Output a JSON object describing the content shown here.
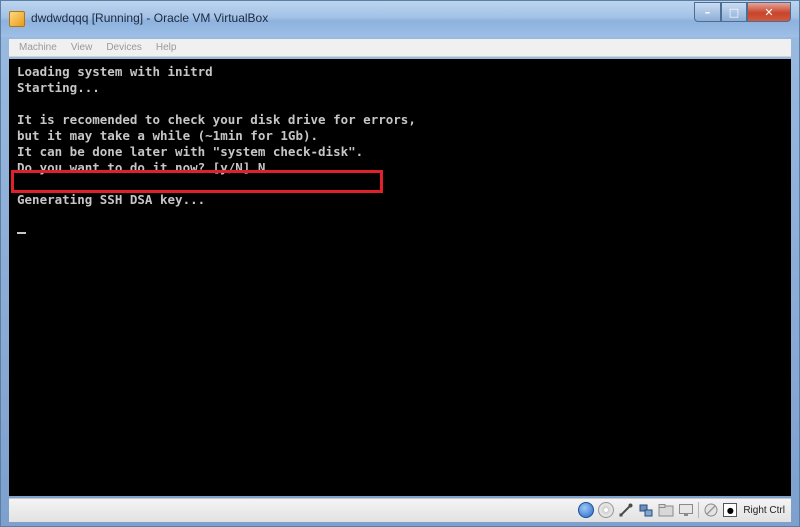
{
  "window": {
    "title": "dwdwdqqq [Running] - Oracle VM VirtualBox"
  },
  "menu": {
    "items": [
      "Machine",
      "View",
      "Devices",
      "Help"
    ]
  },
  "console": {
    "lines": [
      "Loading system with initrd",
      "Starting...",
      "",
      "It is recomended to check your disk drive for errors,",
      "but it may take a while (~1min for 1Gb).",
      "It can be done later with \"system check-disk\".",
      "Do you want to do it now? [y/N] N",
      "",
      "Generating SSH DSA key...",
      ""
    ],
    "highlight_color": "#e0212b"
  },
  "statusbar": {
    "icons": [
      "hard-disk-icon",
      "optical-drive-icon",
      "usb-icon",
      "network-icon",
      "shared-folder-icon",
      "display-icon",
      "mouse-integration-icon",
      "keyboard-capture-icon"
    ],
    "host_key": "Right Ctrl"
  }
}
